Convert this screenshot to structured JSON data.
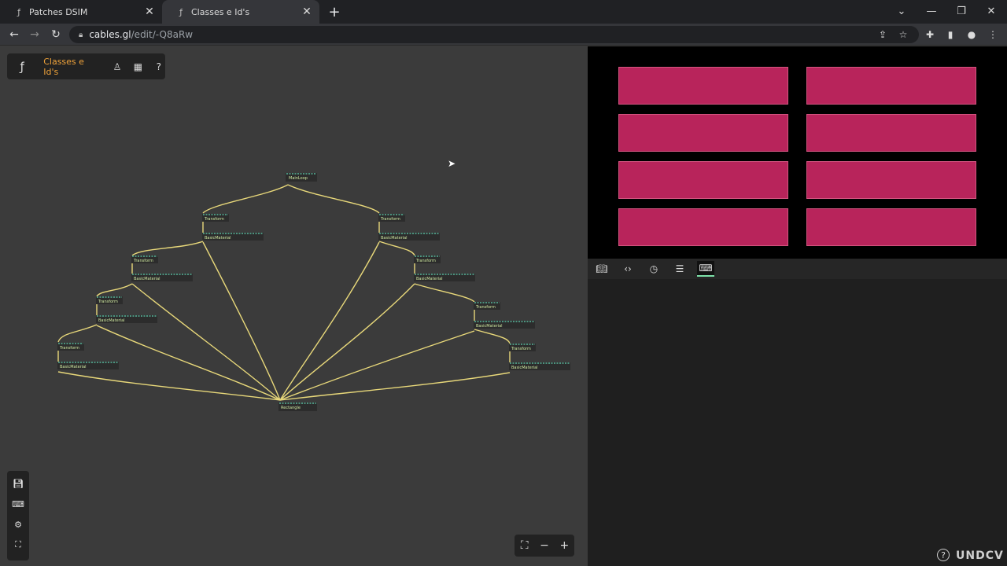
{
  "browser": {
    "tabs": [
      {
        "title": "Patches DSIM",
        "icon": "cables-logo-icon",
        "close": "✕"
      },
      {
        "title": "Classes e Id's",
        "icon": "cables-logo-icon",
        "close": "✕"
      }
    ],
    "new_tab": "+",
    "address": {
      "host": "cables.gl",
      "path": "/edit/-Q8aRw"
    }
  },
  "editor": {
    "project_title": "Classes e Id's",
    "patch": {
      "main_op": "MainLoop",
      "transform_op": "Transform",
      "material_op": "BasicMaterial",
      "mesh_op": "Rectangle"
    },
    "zoom": {
      "fit": "⛶",
      "minus": "−",
      "plus": "+"
    }
  },
  "colors": {
    "accent": "#f0a33a",
    "rect_fill": "#b8245b",
    "active_tab": "#7ce0a8",
    "cable": "#e8d87a"
  },
  "watermark": "UNDCV"
}
